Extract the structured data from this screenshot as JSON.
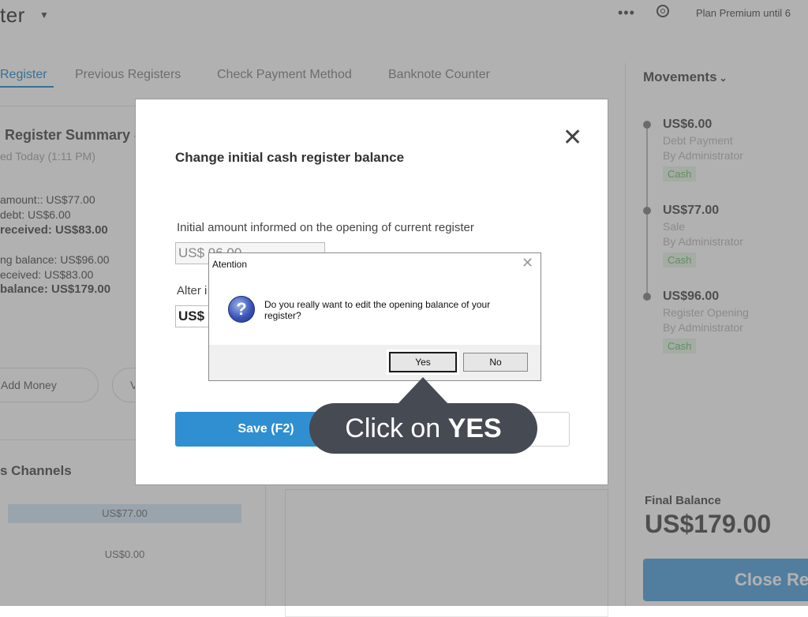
{
  "app": {
    "title": "ter",
    "dots": "•••",
    "plan": "Plan Premium until 6"
  },
  "tabs": [
    {
      "label": "Register",
      "active": true
    },
    {
      "label": "Previous Registers",
      "active": false
    },
    {
      "label": "Check Payment Method",
      "active": false
    },
    {
      "label": "Banknote Counter",
      "active": false
    }
  ],
  "summary": {
    "title": "Register Summary #",
    "subtitle": "ed Today (1:11 PM)",
    "lines": [
      "amount:: US$77.00",
      "debt: US$6.00",
      "received: US$83.00",
      "ng balance: US$96.00",
      "eceived: US$83.00",
      "balance: US$179.00"
    ],
    "add_money": "Add Money",
    "withdraw_partial": "V"
  },
  "channels": {
    "title": "s Channels",
    "values": [
      "US$77.00",
      "US$0.00"
    ]
  },
  "movements": {
    "title": "Movements",
    "items": [
      {
        "amount": "US$6.00",
        "type": "Debt Payment",
        "by": "By Administrator",
        "badge": "Cash"
      },
      {
        "amount": "US$77.00",
        "type": "Sale",
        "by": "By Administrator",
        "badge": "Cash"
      },
      {
        "amount": "US$96.00",
        "type": "Register Opening",
        "by": "By Administrator",
        "badge": "Cash"
      }
    ],
    "final_label": "Final Balance",
    "final_value": "US$179.00",
    "close_button": "Close Re"
  },
  "modal": {
    "title": "Change initial cash register balance",
    "close_glyph": "✕",
    "label_initial": "Initial amount informed on the opening of current register",
    "initial_value": "US$ 96.00",
    "label_alter": "Alter i",
    "alter_value": "US$ 9",
    "save_button": "Save (F2)"
  },
  "dialog": {
    "title": "Atention",
    "close_glyph": "✕",
    "icon": "?",
    "message": "Do you really want to edit the opening balance of your register?",
    "yes": "Yes",
    "no": "No"
  },
  "tooltip": {
    "prefix": "Click on ",
    "emphasis": "YES"
  },
  "colors": {
    "accent": "#2f8fd0",
    "tooltip_bg": "#464a52",
    "badge_green": "#7ac27a"
  }
}
